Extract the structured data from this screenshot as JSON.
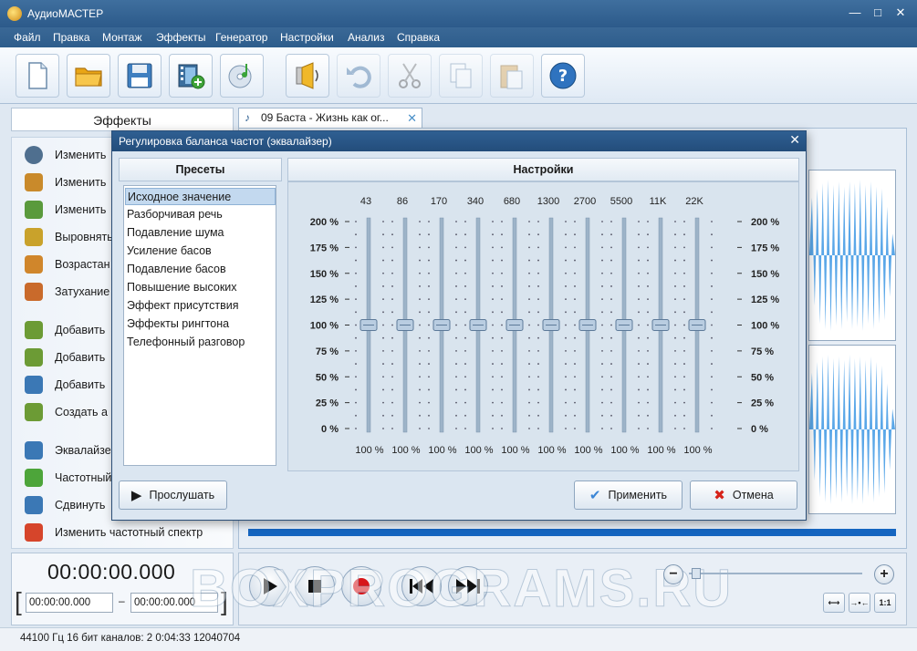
{
  "window": {
    "title": "АудиоМАСТЕР",
    "minimize": "—",
    "maximize": "□",
    "close": "✕"
  },
  "menu": [
    "Файл",
    "Правка",
    "Монтаж",
    "Эффекты",
    "Генератор",
    "Настройки",
    "Анализ",
    "Справка"
  ],
  "toolbar": [
    {
      "name": "new-file",
      "icon": "document-icon",
      "enabled": true
    },
    {
      "name": "open-folder",
      "icon": "folder-icon",
      "enabled": true
    },
    {
      "name": "save",
      "icon": "floppy-icon",
      "enabled": true
    },
    {
      "name": "add-video",
      "icon": "film-add-icon",
      "enabled": true
    },
    {
      "name": "burn-cd",
      "icon": "cd-icon",
      "enabled": true
    },
    {
      "name": "record",
      "icon": "speaker-icon",
      "enabled": true
    },
    {
      "name": "undo",
      "icon": "undo-icon",
      "enabled": false
    },
    {
      "name": "cut",
      "icon": "scissors-icon",
      "enabled": false
    },
    {
      "name": "copy",
      "icon": "copy-icon",
      "enabled": false
    },
    {
      "name": "paste",
      "icon": "paste-icon",
      "enabled": false
    },
    {
      "name": "help",
      "icon": "help-icon",
      "enabled": true
    }
  ],
  "left_panel": {
    "title": "Эффекты",
    "items": [
      {
        "label": "Изменить",
        "icon": "clock-icon",
        "color": "#4f6f8f"
      },
      {
        "label": "Изменить",
        "icon": "person-icon",
        "color": "#c98a2b"
      },
      {
        "label": "Изменить",
        "icon": "speaker-volume-icon",
        "color": "#5a9a3c"
      },
      {
        "label": "Выровнять",
        "icon": "speaker-icon",
        "color": "#c9a22b"
      },
      {
        "label": "Возрастан",
        "icon": "fade-in-icon",
        "color": "#d0862b"
      },
      {
        "label": "Затухание",
        "icon": "fade-out-icon",
        "color": "#c96a2b"
      },
      {
        "label": "Добавить",
        "icon": "speaker-add-icon",
        "color": "#6c9b35"
      },
      {
        "label": "Добавить",
        "icon": "speaker-echo-icon",
        "color": "#6c9b35"
      },
      {
        "label": "Добавить",
        "icon": "reverb-icon",
        "color": "#3b78b5"
      },
      {
        "label": "Создать а",
        "icon": "atmosphere-icon",
        "color": "#6c9b35"
      },
      {
        "label": "Эквалайзе",
        "icon": "equalizer-icon",
        "color": "#3b78b5"
      },
      {
        "label": "Частотный",
        "icon": "filter-icon",
        "color": "#4da53a"
      },
      {
        "label": "Сдвинуть",
        "icon": "shift-icon",
        "color": "#3b78b5"
      },
      {
        "label": "Изменить частотный спектр",
        "icon": "spectrum-icon",
        "color": "#d6452b"
      }
    ]
  },
  "tab": {
    "label": "09 Баста - Жизнь как ог...",
    "close": "✕"
  },
  "dialog": {
    "title": "Регулировка баланса частот (эквалайзер)",
    "close": "✕",
    "presets_title": "Пресеты",
    "settings_title": "Настройки",
    "presets": [
      "Исходное значение",
      "Разборчивая речь",
      "Подавление шума",
      "Усиление басов",
      "Подавление басов",
      "Повышение высоких",
      "Эффект присутствия",
      "Эффекты рингтона",
      "Телефонный разговор"
    ],
    "selected_preset": 0,
    "eq": {
      "bands": [
        "43",
        "86",
        "170",
        "340",
        "680",
        "1300",
        "2700",
        "5500",
        "11K",
        "22K"
      ],
      "values": [
        100,
        100,
        100,
        100,
        100,
        100,
        100,
        100,
        100,
        100
      ],
      "value_labels": [
        "100 %",
        "100 %",
        "100 %",
        "100 %",
        "100 %",
        "100 %",
        "100 %",
        "100 %",
        "100 %",
        "100 %"
      ],
      "scale": [
        "200 %",
        "175 %",
        "150 %",
        "125 %",
        "100 %",
        "75 %",
        "50 %",
        "25 %",
        "0 %"
      ],
      "range": [
        0,
        200
      ]
    },
    "listen_label": "Прослушать",
    "apply_label": "Применить",
    "cancel_label": "Отмена"
  },
  "transport": {
    "current_time": "00:00:00.000",
    "start_time": "00:00:00.000",
    "end_time": "00:00:00.000",
    "zoom_minus": "−",
    "zoom_plus": "+",
    "fit_label": "1:1"
  },
  "watermark": "BOXPROGRAMS.RU",
  "status": "44100 Гц  16 бит  каналов: 2  0:04:33 12040704"
}
